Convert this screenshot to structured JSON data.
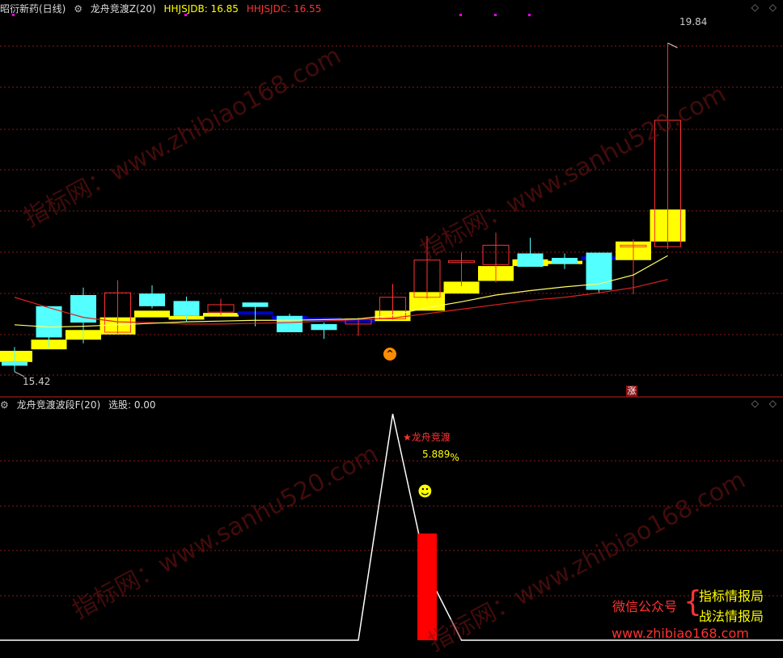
{
  "header": {
    "stock_name": "昭衍新药(日线)",
    "indicator_name": "龙舟竞渡Z(20)",
    "hhjsjdb": "HHJSJDB: 16.85",
    "hhjsjdc": "HHJSJDC: 16.55"
  },
  "lower_header": {
    "indicator_name": "龙舟竞渡波段F(20)",
    "select_value": "选股: 0.00"
  },
  "annotations": {
    "high_label": "19.84",
    "low_label": "15.42",
    "signal_label": "★龙舟竞渡",
    "pct_label": "5.889",
    "pct_sign": "%",
    "rise_tag": "涨",
    "smiley": "☻"
  },
  "promo": {
    "wechat": "微信公众号",
    "brace": "{",
    "line1": "指标情报局",
    "line2": "战法情报局",
    "url": "www.zhibiao168.com"
  },
  "watermarks": [
    "指标网：www.zhibiao168.com",
    "指标网：www.sanhu520.com",
    "指标网：www.sanhu520.com",
    "指标网：www.zhibiao168.com"
  ],
  "colors": {
    "up": "#ff3232",
    "down": "#54ffff",
    "band_yellow": "#ffff00",
    "band_blue": "#0000c8",
    "ma_yellow": "#ffff66",
    "ma_red": "#e02020",
    "grid": "#8a1a1a",
    "spike": "#ffffff",
    "bar": "#ff0000",
    "magenta_dot": "#ff00ff"
  },
  "chart_data": [
    {
      "type": "candlestick",
      "yaxis_range": [
        15.2,
        20.2
      ],
      "candles": [
        {
          "o": 15.55,
          "h": 15.75,
          "l": 15.42,
          "c": 15.5,
          "band": [
            15.55,
            15.7
          ],
          "bandColor": "yellow"
        },
        {
          "o": 16.3,
          "h": 16.3,
          "l": 15.75,
          "c": 15.88,
          "band": [
            15.72,
            15.85
          ],
          "bandColor": "yellow"
        },
        {
          "o": 16.45,
          "h": 16.55,
          "l": 15.8,
          "c": 16.08,
          "band": [
            15.85,
            15.98
          ],
          "bandColor": "yellow"
        },
        {
          "o": 15.95,
          "h": 16.65,
          "l": 15.93,
          "c": 16.48,
          "band": [
            15.92,
            16.15
          ],
          "bandColor": "yellow"
        },
        {
          "o": 16.47,
          "h": 16.58,
          "l": 16.27,
          "c": 16.3,
          "band": [
            16.15,
            16.24
          ],
          "bandColor": "yellow"
        },
        {
          "o": 16.37,
          "h": 16.43,
          "l": 16.1,
          "c": 16.17,
          "band": [
            16.12,
            16.17
          ],
          "bandColor": "yellow"
        },
        {
          "o": 16.22,
          "h": 16.4,
          "l": 16.18,
          "c": 16.32,
          "band": [
            16.16,
            16.21
          ],
          "bandColor": "yellow"
        },
        {
          "o": 16.35,
          "h": 16.35,
          "l": 16.03,
          "c": 16.29,
          "band": [
            16.19,
            16.23
          ],
          "bandColor": "blue"
        },
        {
          "o": 16.17,
          "h": 16.2,
          "l": 15.96,
          "c": 15.95,
          "band": [
            16.12,
            16.17
          ],
          "bandColor": "blue"
        },
        {
          "o": 16.06,
          "h": 16.08,
          "l": 15.86,
          "c": 15.98,
          "band": [
            16.1,
            16.15
          ],
          "bandColor": "blue"
        },
        {
          "o": 16.06,
          "h": 16.15,
          "l": 15.9,
          "c": 16.13,
          "band": [
            16.08,
            16.13
          ],
          "bandColor": "blue"
        },
        {
          "o": 16.13,
          "h": 16.6,
          "l": 16.12,
          "c": 16.42,
          "band": [
            16.1,
            16.24
          ],
          "bandColor": "yellow"
        },
        {
          "o": 16.42,
          "h": 17.24,
          "l": 16.4,
          "c": 16.92,
          "band": [
            16.24,
            16.49
          ],
          "bandColor": "yellow"
        },
        {
          "o": 16.91,
          "h": 17.02,
          "l": 16.57,
          "c": 16.91,
          "band": [
            16.47,
            16.63
          ],
          "bandColor": "yellow"
        },
        {
          "o": 16.86,
          "h": 17.29,
          "l": 16.62,
          "c": 17.12,
          "band": [
            16.64,
            16.84
          ],
          "bandColor": "yellow"
        },
        {
          "o": 17.01,
          "h": 17.22,
          "l": 16.95,
          "c": 16.83,
          "band": [
            16.84,
            16.93
          ],
          "bandColor": "yellow"
        },
        {
          "o": 16.95,
          "h": 17.01,
          "l": 16.8,
          "c": 16.87,
          "band": [
            16.88,
            16.91
          ],
          "bandColor": "yellow"
        },
        {
          "o": 17.02,
          "h": 17.02,
          "l": 16.48,
          "c": 16.52,
          "band": [
            16.92,
            16.97
          ],
          "bandColor": "blue"
        },
        {
          "o": 17.12,
          "h": 17.2,
          "l": 16.46,
          "c": 17.12,
          "band": [
            16.92,
            17.17
          ],
          "bandColor": "yellow"
        },
        {
          "o": 17.1,
          "h": 19.84,
          "l": 17.07,
          "c": 18.8,
          "band": [
            17.17,
            17.6
          ],
          "bandColor": "yellow"
        }
      ],
      "ma_yellow": [
        16.05,
        16.02,
        16.03,
        16.05,
        16.07,
        16.09,
        16.1,
        16.11,
        16.11,
        16.12,
        16.13,
        16.18,
        16.28,
        16.36,
        16.45,
        16.51,
        16.56,
        16.6,
        16.72,
        16.98
      ],
      "ma_red": [
        16.42,
        16.28,
        16.15,
        16.09,
        16.08,
        16.06,
        16.06,
        16.07,
        16.08,
        16.1,
        16.12,
        16.14,
        16.2,
        16.26,
        16.32,
        16.38,
        16.42,
        16.48,
        16.55,
        16.66
      ]
    },
    {
      "type": "bar",
      "yaxis_range": [
        0,
        1
      ],
      "spike_line": [
        0,
        0,
        0,
        0,
        0,
        0,
        0,
        0,
        0,
        0,
        0,
        1,
        0.3,
        0,
        0,
        0,
        0,
        0,
        0,
        0
      ],
      "bar_index": 12,
      "bar_value": 0.5
    }
  ]
}
